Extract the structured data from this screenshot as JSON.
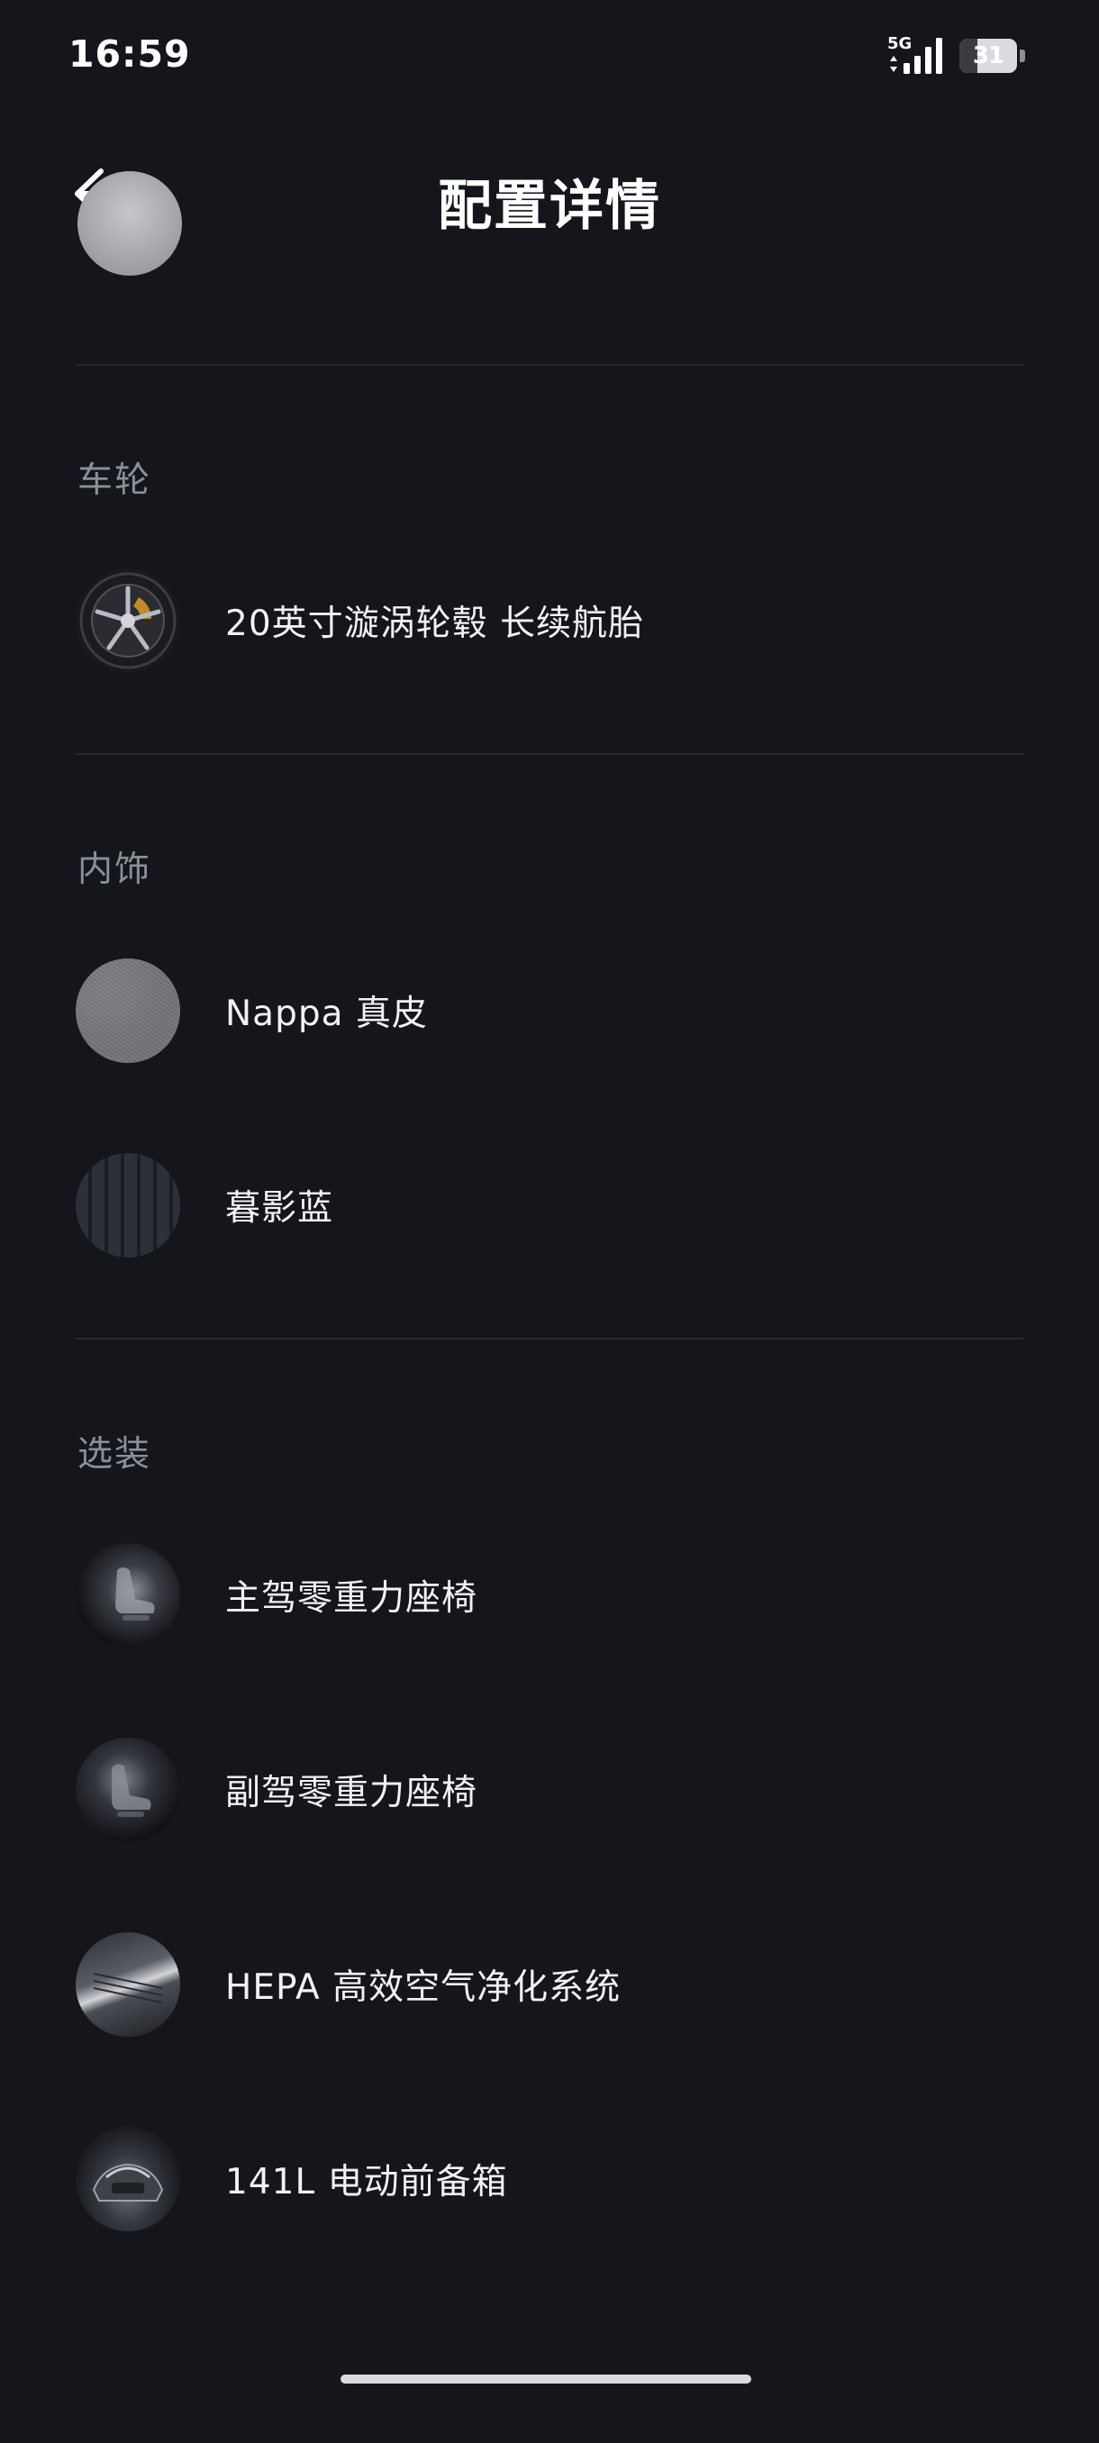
{
  "status_bar": {
    "time": "16:59",
    "network": "5G",
    "battery": "31",
    "battery_level": 0.31
  },
  "header": {
    "title": "配置详情"
  },
  "sections": [
    {
      "title": "车轮",
      "items": [
        {
          "label": "20英寸漩涡轮毂 长续航胎",
          "icon": "wheel-icon"
        }
      ]
    },
    {
      "title": "内饰",
      "items": [
        {
          "label": "Nappa 真皮",
          "icon": "leather-swatch-icon"
        },
        {
          "label": "暮影蓝",
          "icon": "color-swatch-icon"
        }
      ]
    },
    {
      "title": "选装",
      "items": [
        {
          "label": "主驾零重力座椅",
          "icon": "seat-icon"
        },
        {
          "label": "副驾零重力座椅",
          "icon": "seat-icon"
        },
        {
          "label": "HEPA 高效空气净化系统",
          "icon": "air-filter-icon"
        },
        {
          "label": "141L 电动前备箱",
          "icon": "front-trunk-icon"
        }
      ]
    }
  ],
  "colors": {
    "background": "#14161c",
    "section_title": "#8b8f98",
    "divider": "#272a31",
    "text": "#f0f2f5"
  }
}
